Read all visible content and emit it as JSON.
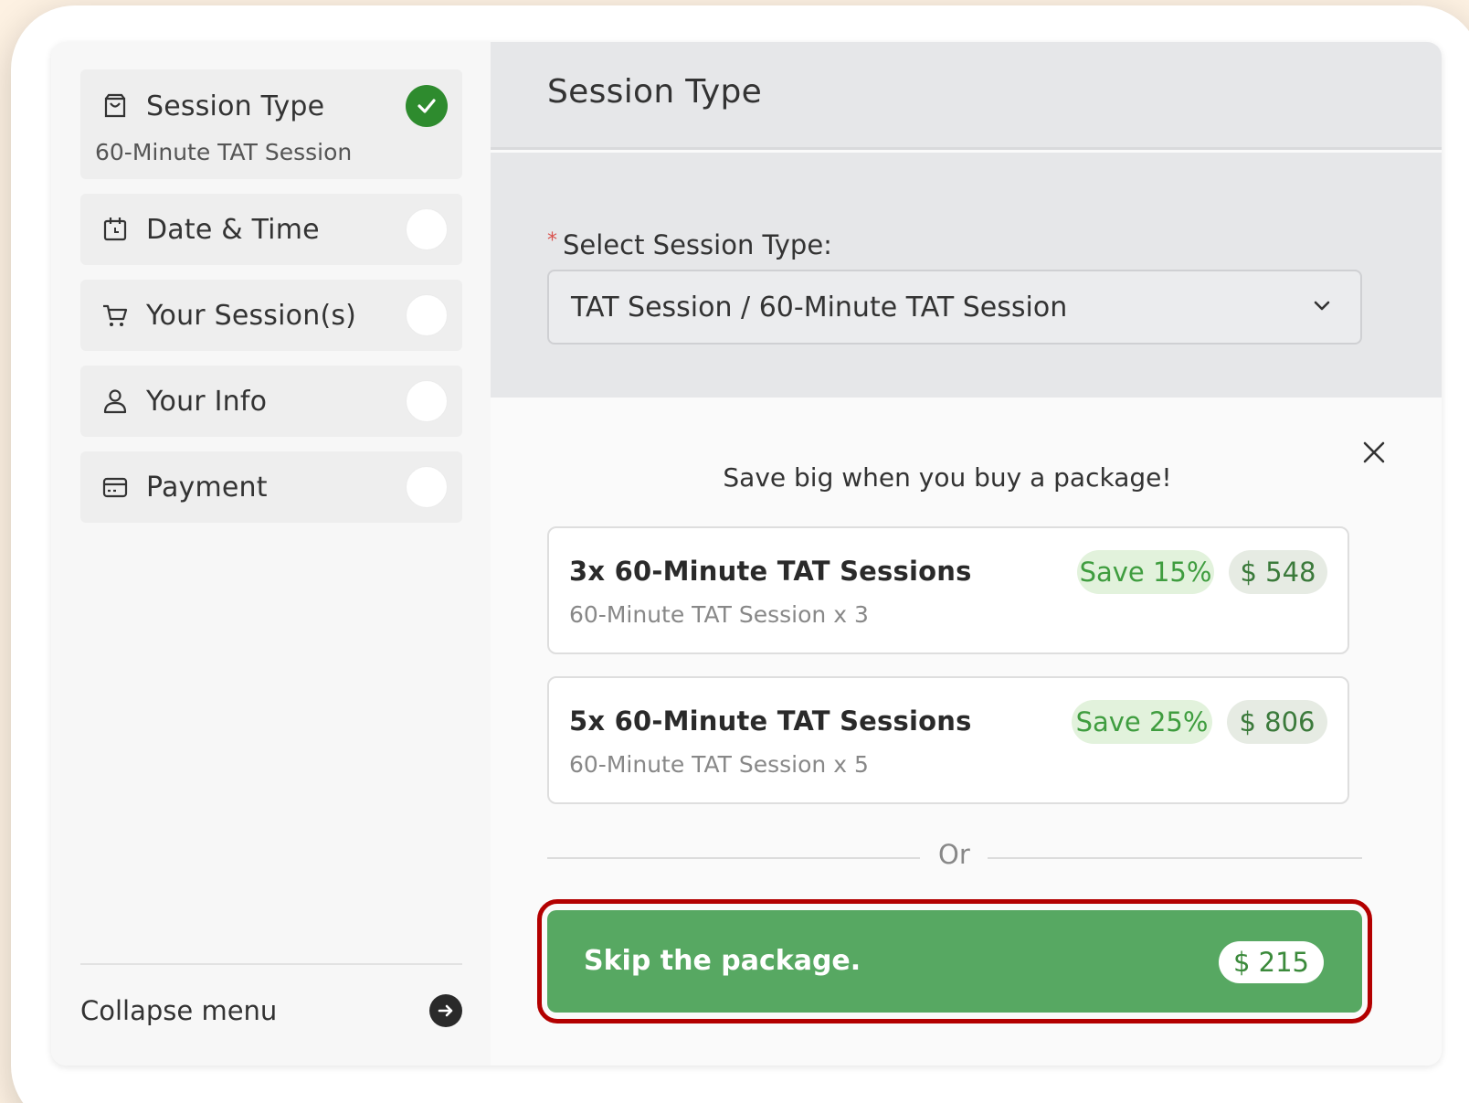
{
  "sidebar": {
    "steps": [
      {
        "label": "Session Type",
        "sub": "60-Minute TAT Session",
        "icon": "store-icon",
        "status": "done"
      },
      {
        "label": "Date & Time",
        "icon": "calendar-icon",
        "status": "pending"
      },
      {
        "label": "Your Session(s)",
        "icon": "cart-icon",
        "status": "pending"
      },
      {
        "label": "Your Info",
        "icon": "user-icon",
        "status": "pending"
      },
      {
        "label": "Payment",
        "icon": "credit-card-icon",
        "status": "pending"
      }
    ],
    "collapse_label": "Collapse menu"
  },
  "main": {
    "title": "Session Type",
    "field_label": "Select Session Type:",
    "required_marker": "*",
    "selected_value": "TAT Session / 60-Minute TAT Session",
    "promo_text": "Save big when you buy a package!",
    "packages": [
      {
        "title": "3x 60-Minute TAT Sessions",
        "sub": "60-Minute TAT Session x 3",
        "save": "Save 15%",
        "price": "$ 548"
      },
      {
        "title": "5x 60-Minute TAT Sessions",
        "sub": "60-Minute TAT Session x 5",
        "save": "Save 25%",
        "price": "$ 806"
      }
    ],
    "or_text": "Or",
    "skip_label": "Skip the package.",
    "skip_price": "$ 215"
  },
  "colors": {
    "accent_green": "#57a862",
    "done_green": "#2e8b2e",
    "highlight_red": "#b30000",
    "background": "#fdf1e2"
  }
}
